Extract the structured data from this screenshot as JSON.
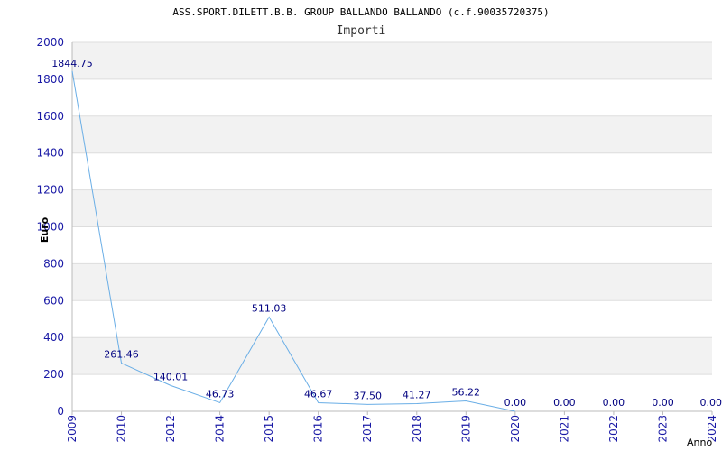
{
  "chart_data": {
    "type": "line",
    "title": "ASS.SPORT.DILETT.B.B. GROUP BALLANDO BALLANDO (c.f.90035720375)",
    "subtitle": "Importi",
    "xlabel": "Anno",
    "ylabel": "Euro",
    "ylim": [
      0,
      2000
    ],
    "yticks": [
      "0",
      "200",
      "400",
      "600",
      "800",
      "1000",
      "1200",
      "1400",
      "1600",
      "1800",
      "2000"
    ],
    "categories": [
      "2009",
      "2010",
      "2012",
      "2014",
      "2015",
      "2016",
      "2017",
      "2018",
      "2019",
      "2020",
      "2021",
      "2022",
      "2023",
      "2024"
    ],
    "values": [
      1844.75,
      261.46,
      140.01,
      46.73,
      511.03,
      46.67,
      37.5,
      41.27,
      56.22,
      0.0,
      0.0,
      0.0,
      0.0,
      0.0
    ],
    "labels": [
      "1844.75",
      "261.46",
      "140.01",
      "46.73",
      "511.03",
      "46.67",
      "37.50",
      "41.27",
      "56.22",
      "0.00",
      "0.00",
      "0.00",
      "0.00",
      "0.00"
    ],
    "line_drawn_points": 10,
    "grid": true,
    "colors": {
      "line": "#6aaee6",
      "band": "#f2f2f2",
      "grid": "#dddddd",
      "tick": "#1a1aa6",
      "label": "#000080"
    }
  }
}
